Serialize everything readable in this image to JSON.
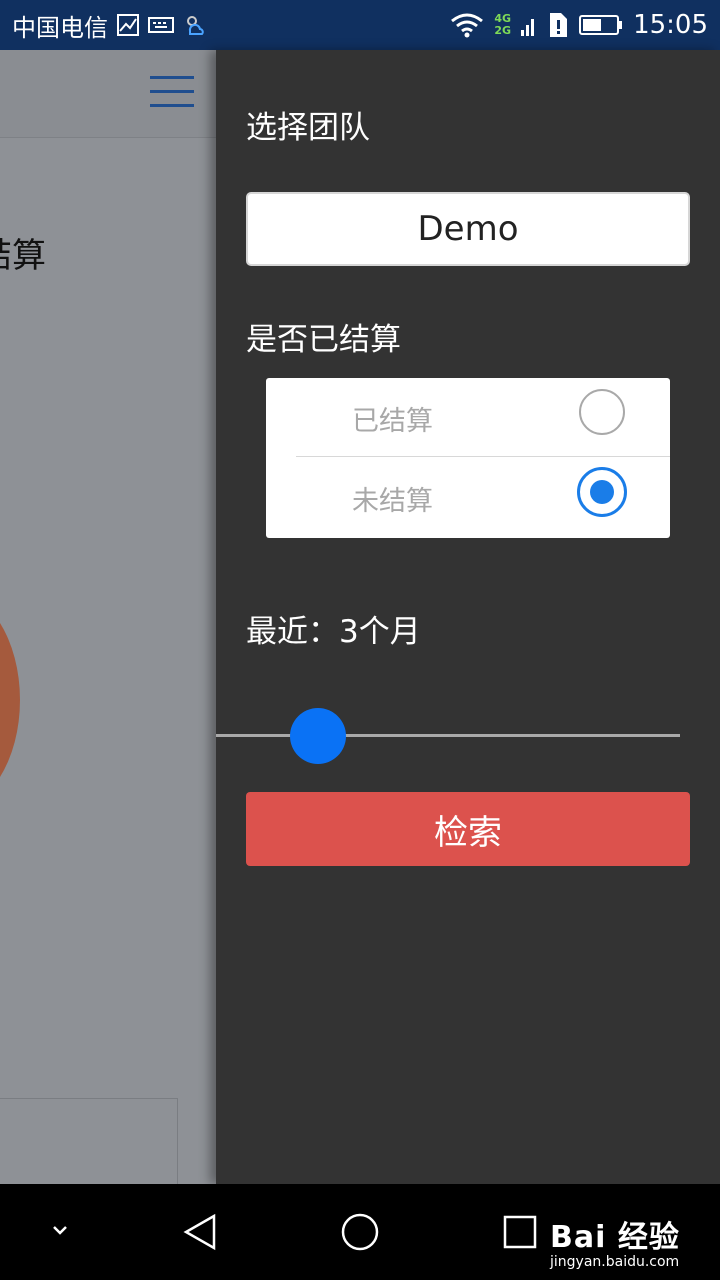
{
  "status_bar": {
    "carrier": "中国电信",
    "net_4g": "4G",
    "net_2g": "2G",
    "time": "15:05"
  },
  "main_page": {
    "title_fragment": "结算"
  },
  "drawer": {
    "team_label": "选择团队",
    "team_value": "Demo",
    "settled_label": "是否已结算",
    "options": [
      {
        "label": "已结算",
        "selected": false
      },
      {
        "label": "未结算",
        "selected": true
      }
    ],
    "recent_label": "最近：3个月",
    "range_value_months": 3,
    "search_label": "检索"
  },
  "watermark": {
    "logo": "Bai 经验",
    "url": "jingyan.baidu.com"
  },
  "colors": {
    "status_bar": "#103060",
    "drawer_bg": "#333333",
    "accent_blue": "#1a7de8",
    "search_red": "#dc524d",
    "dim_page": "#8e9196"
  }
}
